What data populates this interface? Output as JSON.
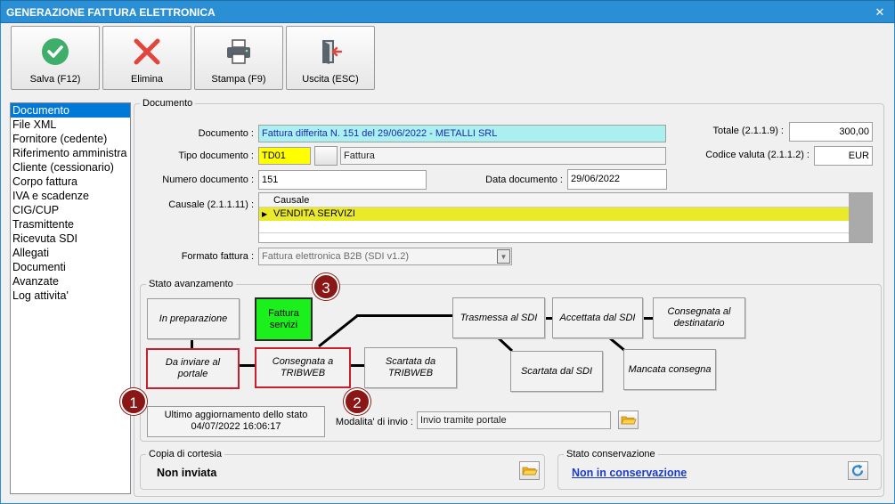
{
  "window": {
    "title": "GENERAZIONE FATTURA ELETTRONICA",
    "close_glyph": "✕"
  },
  "toolbar": {
    "save_label": "Salva (F12)",
    "delete_label": "Elimina",
    "print_label": "Stampa (F9)",
    "exit_label": "Uscita (ESC)"
  },
  "sidebar": {
    "items": [
      {
        "label": "Documento",
        "selected": true
      },
      {
        "label": "File XML"
      },
      {
        "label": "Fornitore (cedente)"
      },
      {
        "label": "Riferimento amministra"
      },
      {
        "label": "Cliente (cessionario)"
      },
      {
        "label": "Corpo fattura"
      },
      {
        "label": "IVA e scadenze"
      },
      {
        "label": "CIG/CUP"
      },
      {
        "label": "Trasmittente"
      },
      {
        "label": "Ricevuta SDI"
      },
      {
        "label": "Allegati"
      },
      {
        "label": "Documenti"
      },
      {
        "label": "Avanzate"
      },
      {
        "label": "Log attivita'"
      }
    ]
  },
  "documento": {
    "group_title": "Documento",
    "documento_label": "Documento :",
    "documento_value": "Fattura differita N. 151 del 29/06/2022 - METALLI SRL",
    "tipo_label": "Tipo documento :",
    "tipo_code": "TD01",
    "tipo_desc": "Fattura",
    "numero_label": "Numero documento :",
    "numero_value": "151",
    "data_label": "Data documento :",
    "data_value": "29/06/2022",
    "totale_label": "Totale (2.1.1.9) :",
    "totale_value": "300,00",
    "valuta_label": "Codice valuta (2.1.1.2) :",
    "valuta_value": "EUR",
    "causale_label": "Causale (2.1.1.11) :",
    "causale_header": "Causale",
    "causale_row": "VENDITA SERVIZI",
    "causale_pointer": "▶",
    "formato_label": "Formato fattura :",
    "formato_value": "Fattura elettronica B2B (SDI v1.2)",
    "dropdown_glyph": "▼"
  },
  "stato": {
    "group_title": "Stato avanzamento",
    "states": {
      "in_preparazione": "In preparazione",
      "da_inviare": "Da inviare al portale",
      "fattura_servizi": "Fattura servizi",
      "consegnata_tribweb": "Consegnata a TRIBWEB",
      "scartata_tribweb": "Scartata da TRIBWEB",
      "trasmessa_sdi": "Trasmessa al SDI",
      "accettata_sdi": "Accettata dal SDI",
      "consegnata_destinatario": "Consegnata al destinatario",
      "scartata_sdi": "Scartata dal SDI",
      "mancata_consegna": "Mancata consegna"
    },
    "badges": [
      "1",
      "2",
      "3"
    ],
    "ultimo_line1": "Ultimo aggiornamento dello stato",
    "ultimo_line2": "04/07/2022 16:06:17",
    "modalita_label": "Modalita' di invio :",
    "modalita_value": "Invio tramite portale"
  },
  "cortesia": {
    "group_title": "Copia di cortesia",
    "value": "Non inviata"
  },
  "conservazione": {
    "group_title": "Stato conservazione",
    "value": "Non in conservazione",
    "link_color": "#1a3cc8"
  }
}
